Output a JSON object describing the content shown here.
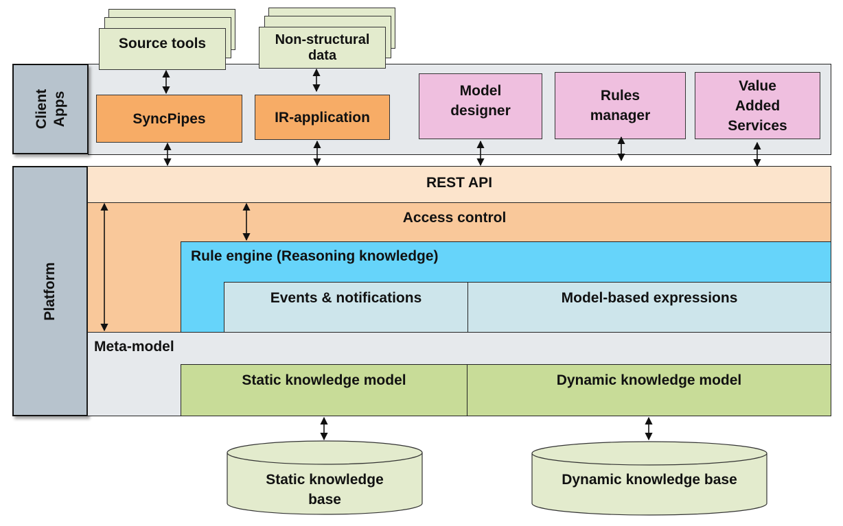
{
  "client_apps": {
    "label_line1": "Client",
    "label_line2": "Apps",
    "source_tools": "Source tools",
    "non_structural_line1": "Non-structural",
    "non_structural_line2": "data",
    "syncpipes": "SyncPipes",
    "ir_application": "IR-application",
    "model_designer_line1": "Model",
    "model_designer_line2": "designer",
    "rules_manager_line1": "Rules",
    "rules_manager_line2": "manager",
    "vas_line1": "Value",
    "vas_line2": "Added",
    "vas_line3": "Services"
  },
  "platform": {
    "label": "Platform",
    "rest_api": "REST API",
    "access_control": "Access control",
    "rule_engine": "Rule engine (Reasoning knowledge)",
    "events_notifications": "Events & notifications",
    "model_based_expressions": "Model-based expressions",
    "meta_model": "Meta-model",
    "static_knowledge_model": "Static knowledge model",
    "dynamic_knowledge_model": "Dynamic knowledge model"
  },
  "storage": {
    "static_kb_line1": "Static knowledge",
    "static_kb_line2": "base",
    "dynamic_kb": "Dynamic knowledge base"
  },
  "colors": {
    "client_bg": "#e6e9ec",
    "side_label": "#b7c3cd",
    "document_green": "#e3ebcd",
    "orange_app": "#f7ac66",
    "pink_app": "#efbfdf",
    "rest_api": "#fce4cc",
    "access_control": "#f9c89a",
    "rule_engine": "#66d4fa",
    "events": "#cde5eb",
    "meta_model": "#e6e9ec",
    "knowledge_model": "#c8dc98",
    "database": "#e3ebcd"
  }
}
